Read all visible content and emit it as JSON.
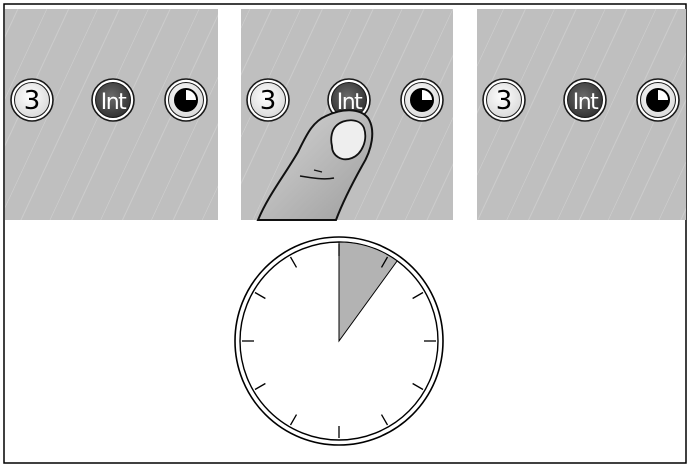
{
  "panels": [
    {
      "buttons": [
        {
          "label": "3",
          "style": "light"
        },
        {
          "label": "Int",
          "style": "dark"
        },
        {
          "icon": "timer-quarter-icon",
          "style": "light"
        }
      ],
      "finger": false
    },
    {
      "buttons": [
        {
          "label": "3",
          "style": "light"
        },
        {
          "label": "Int",
          "style": "dark"
        },
        {
          "icon": "timer-quarter-icon",
          "style": "light"
        }
      ],
      "finger": true
    },
    {
      "buttons": [
        {
          "label": "3",
          "style": "light"
        },
        {
          "label": "Int",
          "style": "dark"
        },
        {
          "icon": "timer-quarter-icon",
          "style": "light"
        }
      ],
      "finger": false
    }
  ],
  "clock": {
    "shaded_fraction": 0.1,
    "tick_count": 12
  },
  "colors": {
    "panel": "#bfbfbf",
    "button_dark": "#4a4a4a",
    "button_light": "#f2f2f2",
    "outline": "#1a1a1a",
    "clock_shade": "#b3b3b3"
  }
}
